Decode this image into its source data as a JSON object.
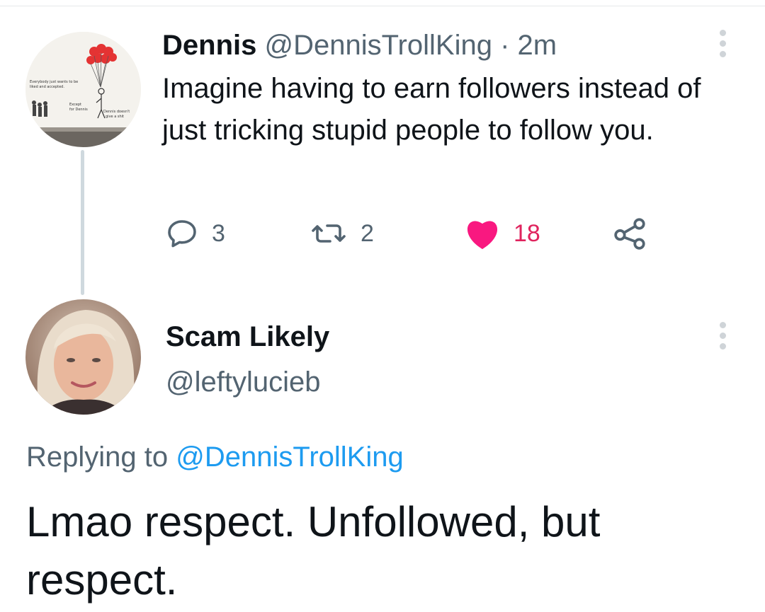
{
  "parent_tweet": {
    "display_name": "Dennis",
    "handle": "@DennisTrollKing",
    "separator": "·",
    "time": "2m",
    "text": "Imagine having to earn followers instead of just tricking stupid people to follow you.",
    "avatar_icon": "balloon-drawing-avatar",
    "avatar_caption_top": "Everybody just wants to be liked and accepted.",
    "avatar_caption_except": "Except for Dennis",
    "avatar_caption_dennis": "Dennis doesn't give a shit",
    "actions": {
      "reply_count": "3",
      "retweet_count": "2",
      "like_count": "18",
      "like_color": "#f91880"
    }
  },
  "reply_tweet": {
    "display_name": "Scam Likely",
    "handle": "@leftylucieb",
    "replying_prefix": "Replying to",
    "replying_to": "@DennisTrollKing",
    "text": "Lmao respect. Unfollowed, but respect."
  },
  "colors": {
    "text": "#0f1419",
    "secondary": "#536471",
    "link": "#1d9bf0",
    "thread_line": "#cfd9de"
  }
}
